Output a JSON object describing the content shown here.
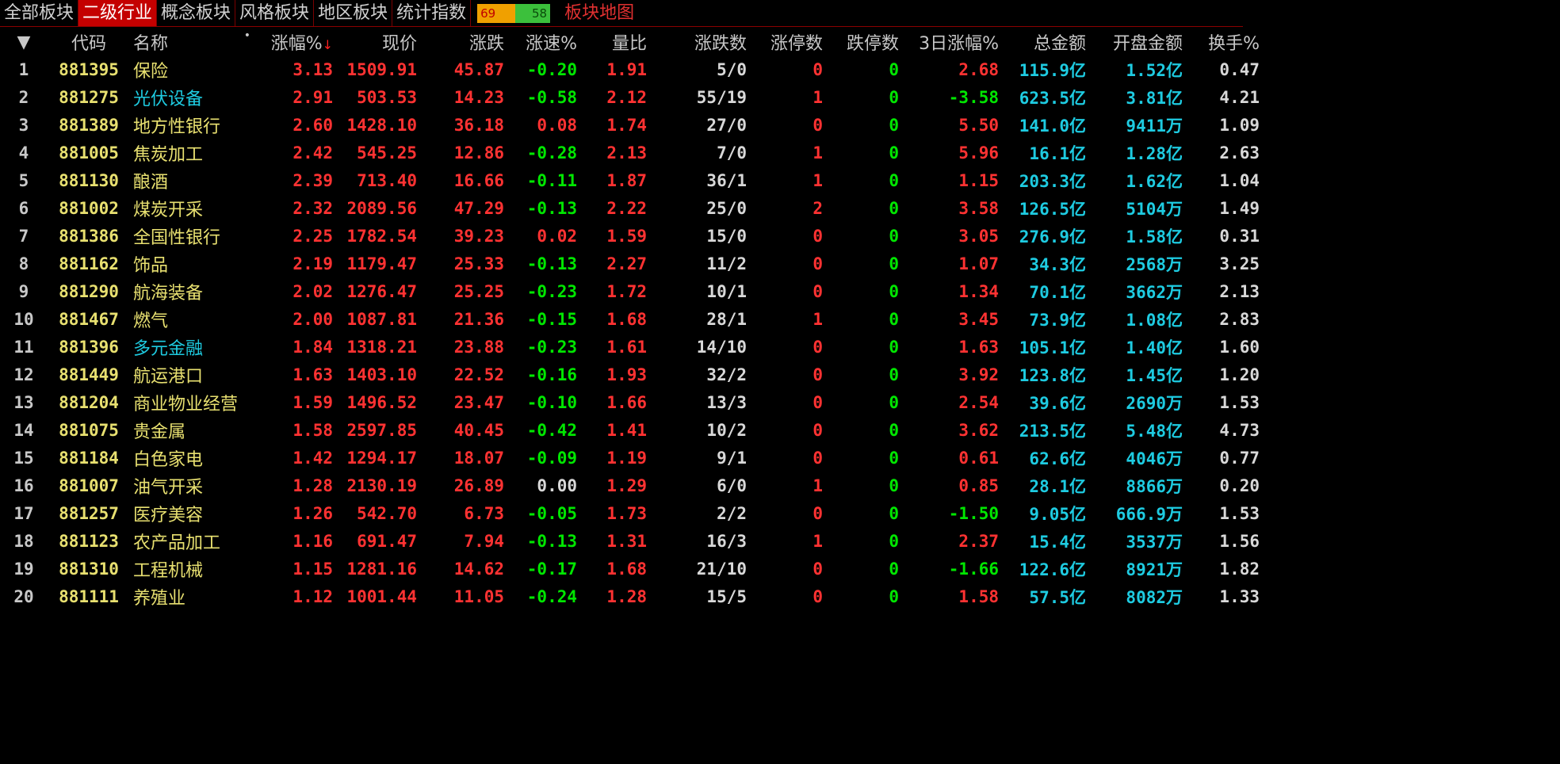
{
  "tabs": [
    {
      "label": "全部板块",
      "active": false
    },
    {
      "label": "二级行业",
      "active": true
    },
    {
      "label": "概念板块",
      "active": false
    },
    {
      "label": "风格板块",
      "active": false
    },
    {
      "label": "地区板块",
      "active": false
    },
    {
      "label": "统计指数",
      "active": false
    }
  ],
  "ratio": {
    "up": "69",
    "down": "58"
  },
  "map_link": "板块地图",
  "headers": {
    "expand": "▼",
    "code": "代码",
    "name": "名称",
    "dot": "•",
    "chg_pct": "涨幅%",
    "sort_arrow": "↓",
    "price": "现价",
    "chg": "涨跌",
    "speed": "涨速%",
    "vol_ratio": "量比",
    "updown": "涨跌数",
    "limit_up": "涨停数",
    "limit_down": "跌停数",
    "chg3d": "3日涨幅%",
    "amount": "总金额",
    "open_amount": "开盘金额",
    "turnover": "换手%"
  },
  "colors": {
    "red": "#ff3232",
    "green": "#00e600",
    "cyan": "#1ecbe1",
    "yellow": "#e8e070",
    "active_tab": "#c40000"
  },
  "rows": [
    {
      "idx": "1",
      "code": "881395",
      "name": "保险",
      "name_color": "yellow",
      "chg_pct": "3.13",
      "price": "1509.91",
      "chg": "45.87",
      "speed": "-0.20",
      "vol_ratio": "1.91",
      "updown": "5/0",
      "limit_up": "0",
      "limit_down": "0",
      "chg3d": "2.68",
      "amount": "115.9亿",
      "open_amount": "1.52亿",
      "turnover": "0.47"
    },
    {
      "idx": "2",
      "code": "881275",
      "name": "光伏设备",
      "name_color": "cyan",
      "chg_pct": "2.91",
      "price": "503.53",
      "chg": "14.23",
      "speed": "-0.58",
      "vol_ratio": "2.12",
      "updown": "55/19",
      "limit_up": "1",
      "limit_down": "0",
      "chg3d": "-3.58",
      "amount": "623.5亿",
      "open_amount": "3.81亿",
      "turnover": "4.21"
    },
    {
      "idx": "3",
      "code": "881389",
      "name": "地方性银行",
      "name_color": "yellow",
      "chg_pct": "2.60",
      "price": "1428.10",
      "chg": "36.18",
      "speed": "0.08",
      "vol_ratio": "1.74",
      "updown": "27/0",
      "limit_up": "0",
      "limit_down": "0",
      "chg3d": "5.50",
      "amount": "141.0亿",
      "open_amount": "9411万",
      "turnover": "1.09"
    },
    {
      "idx": "4",
      "code": "881005",
      "name": "焦炭加工",
      "name_color": "yellow",
      "chg_pct": "2.42",
      "price": "545.25",
      "chg": "12.86",
      "speed": "-0.28",
      "vol_ratio": "2.13",
      "updown": "7/0",
      "limit_up": "1",
      "limit_down": "0",
      "chg3d": "5.96",
      "amount": "16.1亿",
      "open_amount": "1.28亿",
      "turnover": "2.63"
    },
    {
      "idx": "5",
      "code": "881130",
      "name": "酿酒",
      "name_color": "yellow",
      "chg_pct": "2.39",
      "price": "713.40",
      "chg": "16.66",
      "speed": "-0.11",
      "vol_ratio": "1.87",
      "updown": "36/1",
      "limit_up": "1",
      "limit_down": "0",
      "chg3d": "1.15",
      "amount": "203.3亿",
      "open_amount": "1.62亿",
      "turnover": "1.04"
    },
    {
      "idx": "6",
      "code": "881002",
      "name": "煤炭开采",
      "name_color": "yellow",
      "chg_pct": "2.32",
      "price": "2089.56",
      "chg": "47.29",
      "speed": "-0.13",
      "vol_ratio": "2.22",
      "updown": "25/0",
      "limit_up": "2",
      "limit_down": "0",
      "chg3d": "3.58",
      "amount": "126.5亿",
      "open_amount": "5104万",
      "turnover": "1.49"
    },
    {
      "idx": "7",
      "code": "881386",
      "name": "全国性银行",
      "name_color": "yellow",
      "chg_pct": "2.25",
      "price": "1782.54",
      "chg": "39.23",
      "speed": "0.02",
      "vol_ratio": "1.59",
      "updown": "15/0",
      "limit_up": "0",
      "limit_down": "0",
      "chg3d": "3.05",
      "amount": "276.9亿",
      "open_amount": "1.58亿",
      "turnover": "0.31"
    },
    {
      "idx": "8",
      "code": "881162",
      "name": "饰品",
      "name_color": "yellow",
      "chg_pct": "2.19",
      "price": "1179.47",
      "chg": "25.33",
      "speed": "-0.13",
      "vol_ratio": "2.27",
      "updown": "11/2",
      "limit_up": "0",
      "limit_down": "0",
      "chg3d": "1.07",
      "amount": "34.3亿",
      "open_amount": "2568万",
      "turnover": "3.25"
    },
    {
      "idx": "9",
      "code": "881290",
      "name": "航海装备",
      "name_color": "yellow",
      "chg_pct": "2.02",
      "price": "1276.47",
      "chg": "25.25",
      "speed": "-0.23",
      "vol_ratio": "1.72",
      "updown": "10/1",
      "limit_up": "0",
      "limit_down": "0",
      "chg3d": "1.34",
      "amount": "70.1亿",
      "open_amount": "3662万",
      "turnover": "2.13"
    },
    {
      "idx": "10",
      "code": "881467",
      "name": "燃气",
      "name_color": "yellow",
      "chg_pct": "2.00",
      "price": "1087.81",
      "chg": "21.36",
      "speed": "-0.15",
      "vol_ratio": "1.68",
      "updown": "28/1",
      "limit_up": "1",
      "limit_down": "0",
      "chg3d": "3.45",
      "amount": "73.9亿",
      "open_amount": "1.08亿",
      "turnover": "2.83"
    },
    {
      "idx": "11",
      "code": "881396",
      "name": "多元金融",
      "name_color": "cyan",
      "chg_pct": "1.84",
      "price": "1318.21",
      "chg": "23.88",
      "speed": "-0.23",
      "vol_ratio": "1.61",
      "updown": "14/10",
      "limit_up": "0",
      "limit_down": "0",
      "chg3d": "1.63",
      "amount": "105.1亿",
      "open_amount": "1.40亿",
      "turnover": "1.60"
    },
    {
      "idx": "12",
      "code": "881449",
      "name": "航运港口",
      "name_color": "yellow",
      "chg_pct": "1.63",
      "price": "1403.10",
      "chg": "22.52",
      "speed": "-0.16",
      "vol_ratio": "1.93",
      "updown": "32/2",
      "limit_up": "0",
      "limit_down": "0",
      "chg3d": "3.92",
      "amount": "123.8亿",
      "open_amount": "1.45亿",
      "turnover": "1.20"
    },
    {
      "idx": "13",
      "code": "881204",
      "name": "商业物业经营",
      "name_color": "yellow",
      "chg_pct": "1.59",
      "price": "1496.52",
      "chg": "23.47",
      "speed": "-0.10",
      "vol_ratio": "1.66",
      "updown": "13/3",
      "limit_up": "0",
      "limit_down": "0",
      "chg3d": "2.54",
      "amount": "39.6亿",
      "open_amount": "2690万",
      "turnover": "1.53"
    },
    {
      "idx": "14",
      "code": "881075",
      "name": "贵金属",
      "name_color": "yellow",
      "chg_pct": "1.58",
      "price": "2597.85",
      "chg": "40.45",
      "speed": "-0.42",
      "vol_ratio": "1.41",
      "updown": "10/2",
      "limit_up": "0",
      "limit_down": "0",
      "chg3d": "3.62",
      "amount": "213.5亿",
      "open_amount": "5.48亿",
      "turnover": "4.73"
    },
    {
      "idx": "15",
      "code": "881184",
      "name": "白色家电",
      "name_color": "yellow",
      "chg_pct": "1.42",
      "price": "1294.17",
      "chg": "18.07",
      "speed": "-0.09",
      "vol_ratio": "1.19",
      "updown": "9/1",
      "limit_up": "0",
      "limit_down": "0",
      "chg3d": "0.61",
      "amount": "62.6亿",
      "open_amount": "4046万",
      "turnover": "0.77"
    },
    {
      "idx": "16",
      "code": "881007",
      "name": "油气开采",
      "name_color": "yellow",
      "chg_pct": "1.28",
      "price": "2130.19",
      "chg": "26.89",
      "speed": "0.00",
      "vol_ratio": "1.29",
      "updown": "6/0",
      "limit_up": "1",
      "limit_down": "0",
      "chg3d": "0.85",
      "amount": "28.1亿",
      "open_amount": "8866万",
      "turnover": "0.20"
    },
    {
      "idx": "17",
      "code": "881257",
      "name": "医疗美容",
      "name_color": "yellow",
      "chg_pct": "1.26",
      "price": "542.70",
      "chg": "6.73",
      "speed": "-0.05",
      "vol_ratio": "1.73",
      "updown": "2/2",
      "limit_up": "0",
      "limit_down": "0",
      "chg3d": "-1.50",
      "amount": "9.05亿",
      "open_amount": "666.9万",
      "turnover": "1.53"
    },
    {
      "idx": "18",
      "code": "881123",
      "name": "农产品加工",
      "name_color": "yellow",
      "chg_pct": "1.16",
      "price": "691.47",
      "chg": "7.94",
      "speed": "-0.13",
      "vol_ratio": "1.31",
      "updown": "16/3",
      "limit_up": "1",
      "limit_down": "0",
      "chg3d": "2.37",
      "amount": "15.4亿",
      "open_amount": "3537万",
      "turnover": "1.56"
    },
    {
      "idx": "19",
      "code": "881310",
      "name": "工程机械",
      "name_color": "yellow",
      "chg_pct": "1.15",
      "price": "1281.16",
      "chg": "14.62",
      "speed": "-0.17",
      "vol_ratio": "1.68",
      "updown": "21/10",
      "limit_up": "0",
      "limit_down": "0",
      "chg3d": "-1.66",
      "amount": "122.6亿",
      "open_amount": "8921万",
      "turnover": "1.82"
    },
    {
      "idx": "20",
      "code": "881111",
      "name": "养殖业",
      "name_color": "yellow",
      "chg_pct": "1.12",
      "price": "1001.44",
      "chg": "11.05",
      "speed": "-0.24",
      "vol_ratio": "1.28",
      "updown": "15/5",
      "limit_up": "0",
      "limit_down": "0",
      "chg3d": "1.58",
      "amount": "57.5亿",
      "open_amount": "8082万",
      "turnover": "1.33"
    }
  ]
}
